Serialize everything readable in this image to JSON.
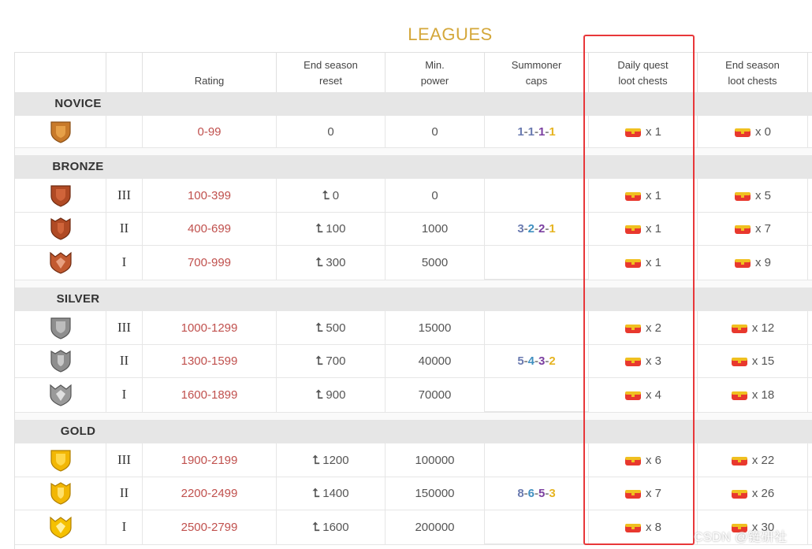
{
  "title": "LEAGUES",
  "headers": {
    "rating": "Rating",
    "end_season_reset": "End season\nreset",
    "min_power": "Min.\npower",
    "summoner_caps": "Summoner\ncaps",
    "daily_quest_loot": "Daily quest\nloot chests",
    "end_season_loot": "End season\nloot chests"
  },
  "sections": {
    "novice": "NOVICE",
    "bronze": "BRONZE",
    "silver": "SILVER",
    "gold": "GOLD"
  },
  "colors": {
    "novice": "#c87a2a",
    "bronze": "#b04a24",
    "silver": "#8e8e8e",
    "gold": "#f2b705",
    "highlight": "#e8373a",
    "rating": "#c0504d"
  },
  "caps": {
    "novice": [
      "1",
      "1",
      "1",
      "1"
    ],
    "bronze": [
      "3",
      "2",
      "2",
      "1"
    ],
    "silver": [
      "5",
      "4",
      "3",
      "2"
    ],
    "gold": [
      "8",
      "6",
      "5",
      "3"
    ],
    "sep": "-"
  },
  "rows": {
    "novice": {
      "tier": "",
      "rating": "0-99",
      "reset": "0",
      "power": "0",
      "daily": "x 1",
      "season": "x 0"
    },
    "bronze3": {
      "tier": "III",
      "rating": "100-399",
      "reset": "0",
      "power": "0",
      "daily": "x 1",
      "season": "x 5"
    },
    "bronze2": {
      "tier": "II",
      "rating": "400-699",
      "reset": "100",
      "power": "1000",
      "daily": "x 1",
      "season": "x 7"
    },
    "bronze1": {
      "tier": "I",
      "rating": "700-999",
      "reset": "300",
      "power": "5000",
      "daily": "x 1",
      "season": "x 9"
    },
    "silver3": {
      "tier": "III",
      "rating": "1000-1299",
      "reset": "500",
      "power": "15000",
      "daily": "x 2",
      "season": "x 12"
    },
    "silver2": {
      "tier": "II",
      "rating": "1300-1599",
      "reset": "700",
      "power": "40000",
      "daily": "x 3",
      "season": "x 15"
    },
    "silver1": {
      "tier": "I",
      "rating": "1600-1899",
      "reset": "900",
      "power": "70000",
      "daily": "x 4",
      "season": "x 18"
    },
    "gold3": {
      "tier": "III",
      "rating": "1900-2199",
      "reset": "1200",
      "power": "100000",
      "daily": "x 6",
      "season": "x 22"
    },
    "gold2": {
      "tier": "II",
      "rating": "2200-2499",
      "reset": "1400",
      "power": "150000",
      "daily": "x 7",
      "season": "x 26"
    },
    "gold1": {
      "tier": "I",
      "rating": "2500-2799",
      "reset": "1600",
      "power": "200000",
      "daily": "x 8",
      "season": "x 30"
    }
  },
  "watermark": "CSDN @链研社"
}
